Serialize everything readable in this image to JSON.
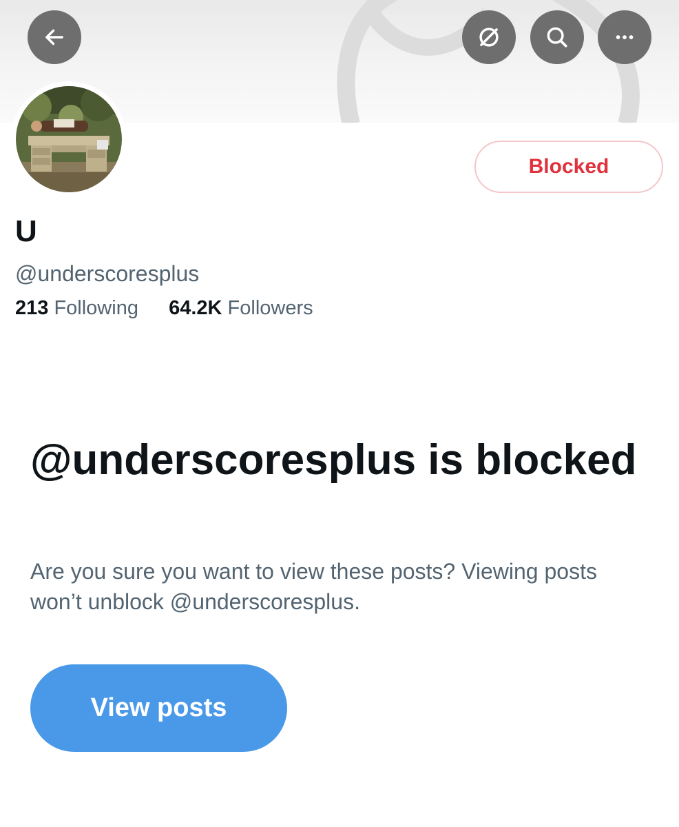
{
  "header": {
    "back_icon": "arrow-left-icon",
    "grok_icon": "grok-icon",
    "search_icon": "search-icon",
    "more_icon": "more-horizontal-icon",
    "button_color": "#6e6e6e"
  },
  "profile": {
    "display_name": "U",
    "handle": "@underscoresplus",
    "blocked_label": "Blocked",
    "stats": {
      "following_count": "213",
      "following_label": "Following",
      "followers_count": "64.2K",
      "followers_label": "Followers"
    }
  },
  "blocked_notice": {
    "title": "@underscoresplus is blocked",
    "description": "Are you sure you want to view these posts? Viewing posts won’t unblock @underscoresplus.",
    "view_button_label": "View posts"
  },
  "colors": {
    "blocked_red": "#e0313c",
    "accent_blue": "#4a99e9",
    "secondary_text": "#536471",
    "primary_text": "#0f1419"
  }
}
